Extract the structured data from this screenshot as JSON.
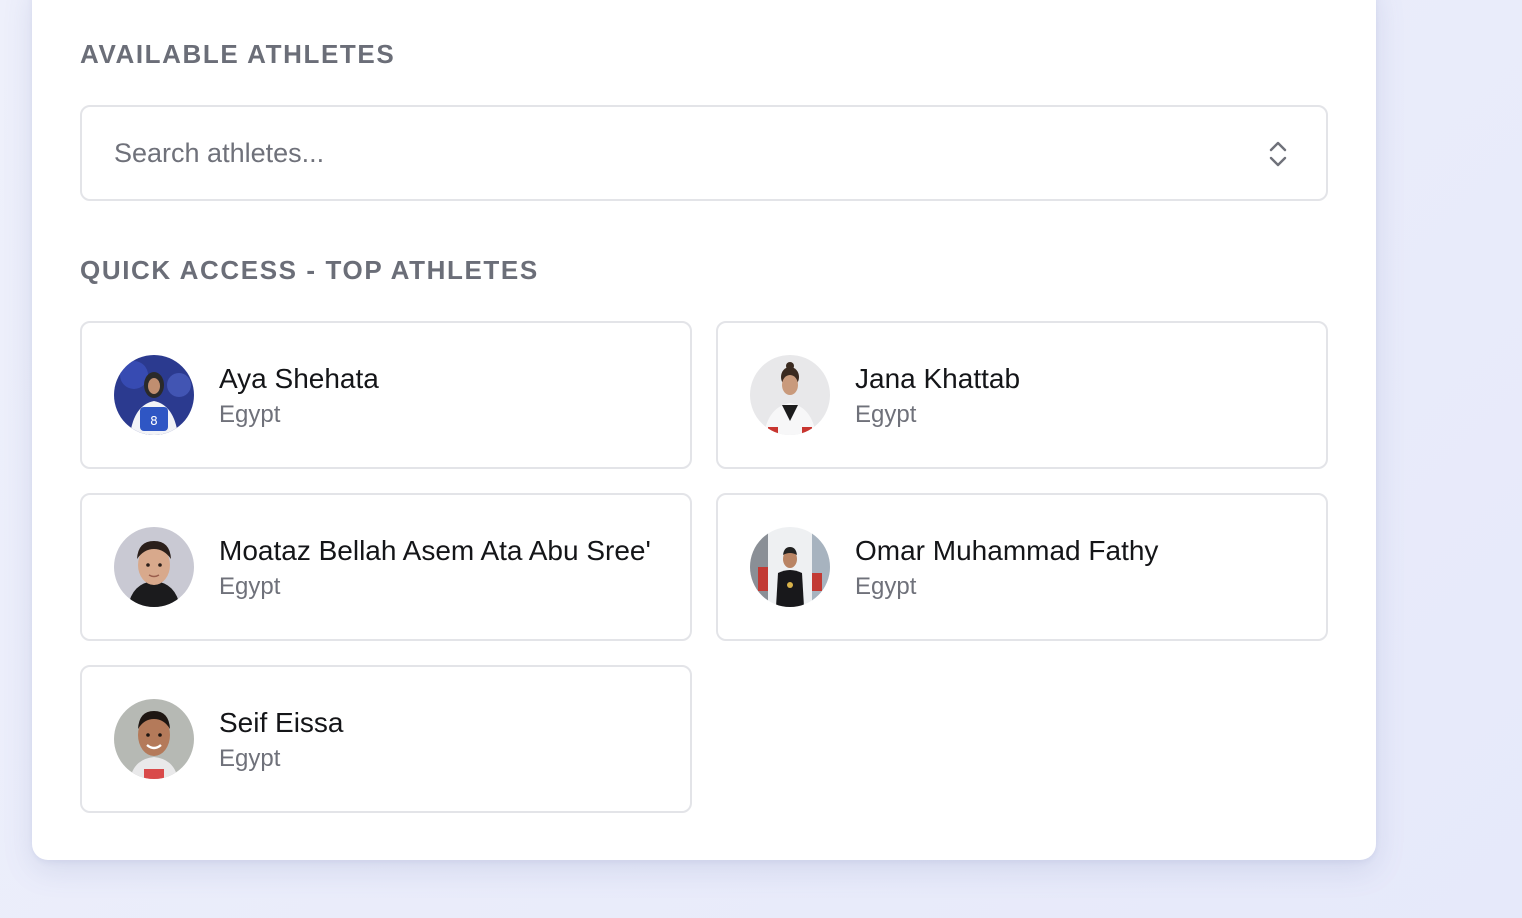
{
  "available": {
    "heading": "AVAILABLE ATHLETES",
    "search_placeholder": "Search athletes..."
  },
  "quick_access": {
    "heading": "QUICK ACCESS - TOP ATHLETES",
    "athletes": [
      {
        "name": "Aya Shehata",
        "country": "Egypt"
      },
      {
        "name": "Jana Khattab",
        "country": "Egypt"
      },
      {
        "name": "Moataz Bellah Asem Ata Abu Sree'",
        "country": "Egypt"
      },
      {
        "name": "Omar Muhammad Fathy",
        "country": "Egypt"
      },
      {
        "name": "Seif Eissa",
        "country": "Egypt"
      }
    ]
  },
  "icons": {
    "search_toggle": "chevron-up-down-icon"
  },
  "colors": {
    "page_background": "#e8eaf9",
    "panel_background": "#ffffff",
    "heading_text": "#6b6e78",
    "border": "#e3e4e8"
  }
}
